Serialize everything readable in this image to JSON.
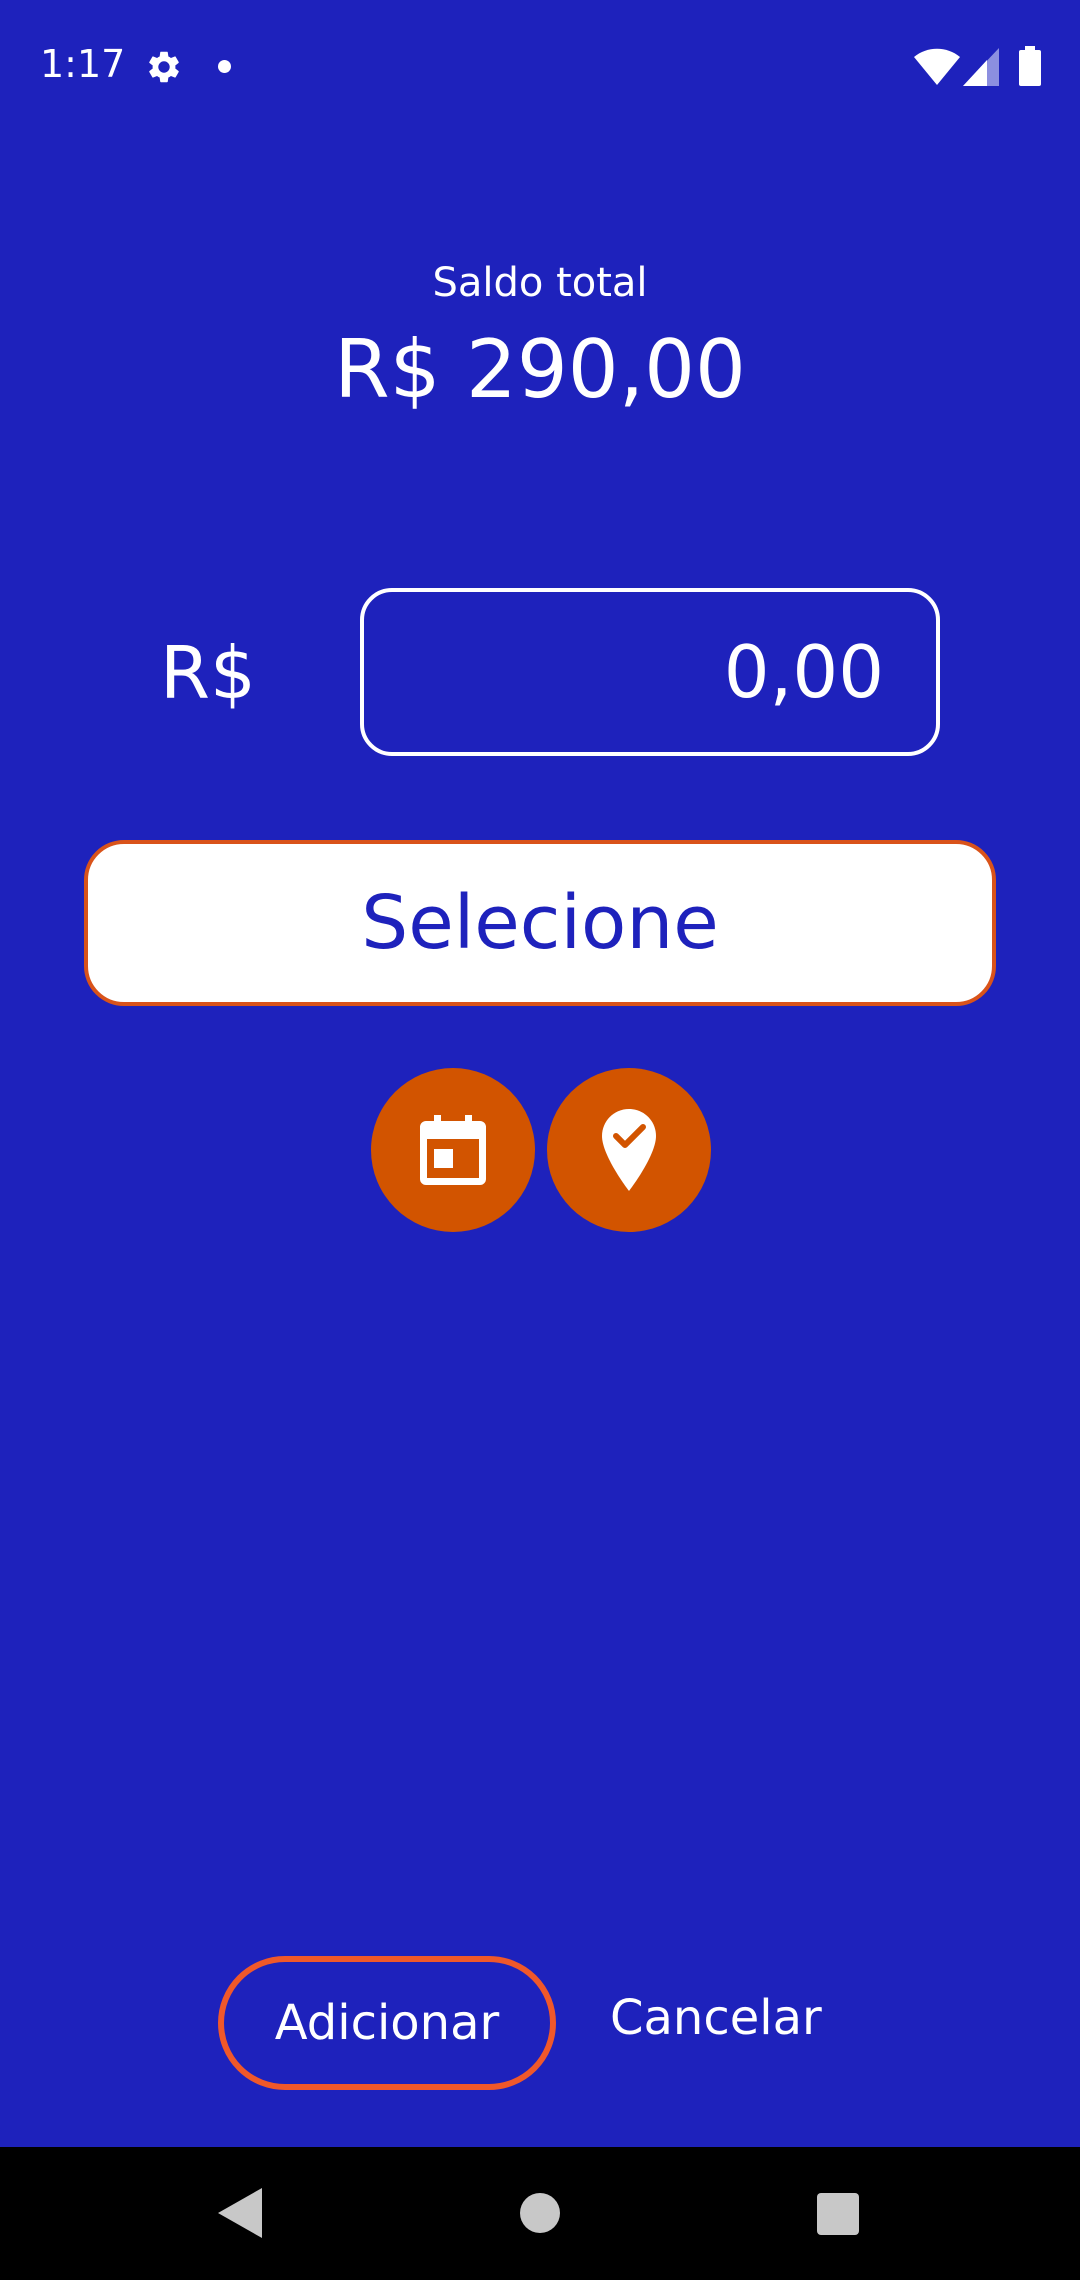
{
  "status_bar": {
    "time": "1:17",
    "icons": [
      "gear-icon",
      "notification-dot-icon",
      "wifi-icon",
      "signal-icon",
      "battery-icon"
    ]
  },
  "balance": {
    "label": "Saldo total",
    "value": "R$ 290,00"
  },
  "amount": {
    "currency": "R$",
    "placeholder": "0,00"
  },
  "category_select": {
    "selected": "Selecione"
  },
  "actions": {
    "calendar_icon": "calendar-icon",
    "location_icon": "location-check-icon",
    "add_label": "Adicionar",
    "cancel_label": "Cancelar"
  },
  "navigation": {
    "icons": [
      "back-icon",
      "home-icon",
      "recents-icon"
    ]
  },
  "colors": {
    "background": "#1e22bc",
    "accent": "#d25400",
    "outline_accent": "#f0582a",
    "white": "#ffffff",
    "nav_bar": "#000000"
  }
}
